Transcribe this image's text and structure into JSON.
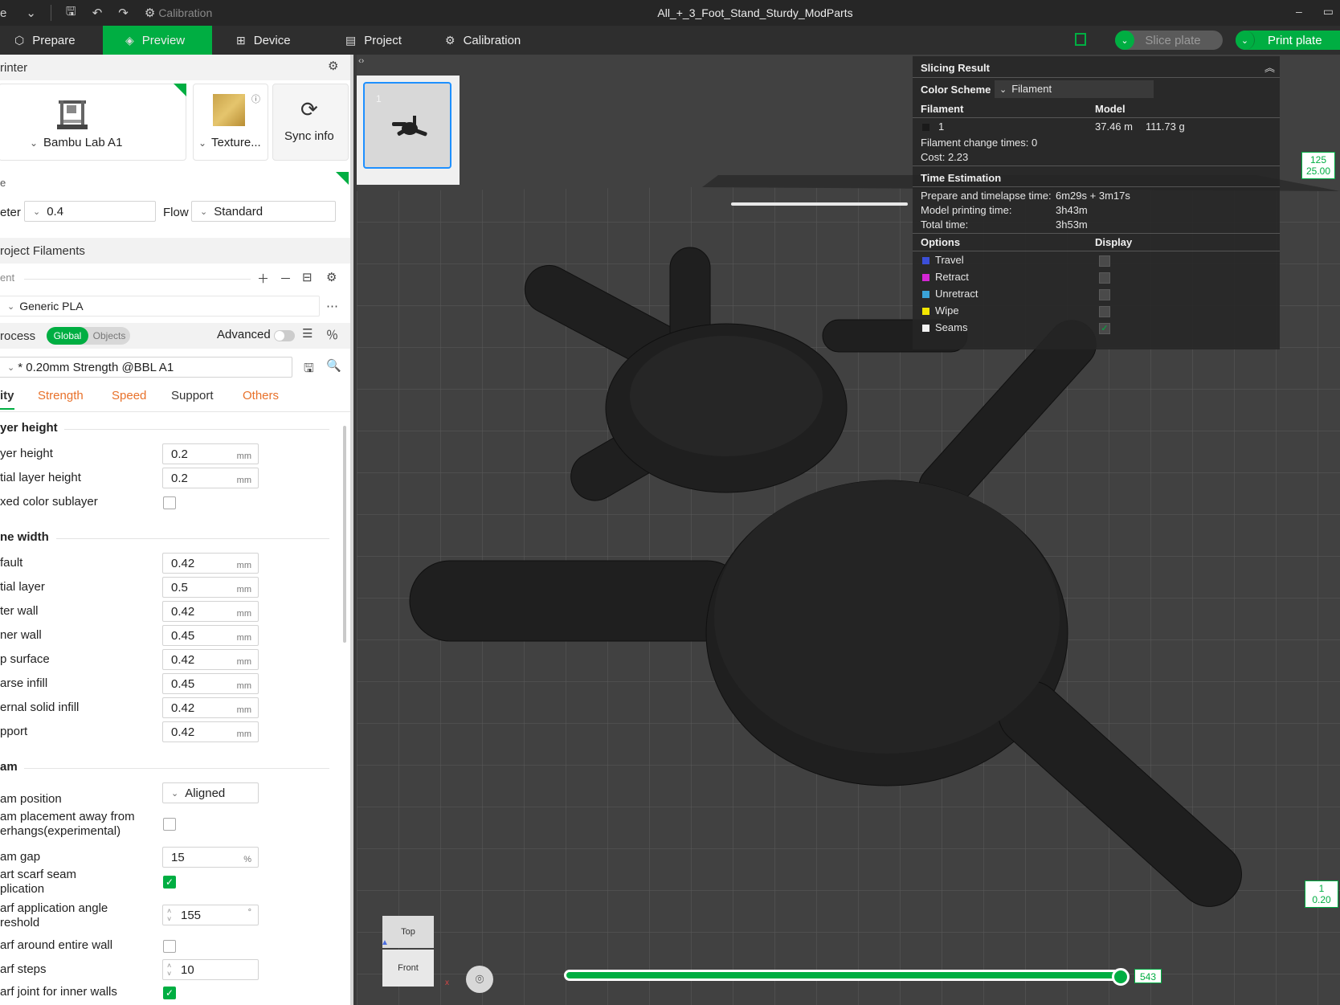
{
  "titlebar": {
    "app_menu": "e",
    "calibration_label": "Calibration",
    "title": "All_+_3_Foot_Stand_Sturdy_ModParts"
  },
  "nav": {
    "tabs": [
      {
        "label": "Prepare"
      },
      {
        "label": "Preview"
      },
      {
        "label": "Device"
      },
      {
        "label": "Project"
      },
      {
        "label": "Calibration"
      }
    ],
    "slice_label": "Slice plate",
    "print_label": "Print plate"
  },
  "printer": {
    "header": "rinter",
    "printer_name": "Bambu Lab A1",
    "plate_name": "Texture...",
    "sync_label": "Sync info",
    "nozzle_section": "e",
    "diameter_label": "eter",
    "diameter_value": "0.4",
    "flow_label": "Flow",
    "flow_value": "Standard"
  },
  "filaments": {
    "header": "roject Filaments",
    "sub_label": "ent",
    "item": "Generic PLA"
  },
  "process": {
    "header": "rocess",
    "toggle_global": "Global",
    "toggle_objects": "Objects",
    "advanced_label": "Advanced",
    "preset": "* 0.20mm Strength @BBL A1",
    "tabs": [
      "ity",
      "Strength",
      "Speed",
      "Support",
      "Others"
    ]
  },
  "settings": {
    "layer_height_group": "yer height",
    "layer_height_label": "yer height",
    "layer_height_value": "0.2",
    "initial_layer_height_label": "tial layer height",
    "initial_layer_height_value": "0.2",
    "mixed_color_label": "xed color sublayer",
    "line_width_group": "ne width",
    "default_label": "fault",
    "default_value": "0.42",
    "initial_layer_label": "tial layer",
    "initial_layer_value": "0.5",
    "outer_wall_label": "ter wall",
    "outer_wall_value": "0.42",
    "inner_wall_label": "ner wall",
    "inner_wall_value": "0.45",
    "top_surface_label": "p surface",
    "top_surface_value": "0.42",
    "sparse_infill_label": "arse infill",
    "sparse_infill_value": "0.45",
    "internal_solid_label": "ernal solid infill",
    "internal_solid_value": "0.42",
    "support_label": "pport",
    "support_value": "0.42",
    "seam_group": "am",
    "seam_position_label": "am position",
    "seam_position_value": "Aligned",
    "seam_away_label_1": "am placement away from",
    "seam_away_label_2": "erhangs(experimental)",
    "seam_gap_label": "am gap",
    "seam_gap_value": "15",
    "smart_scarf_label_1": "art scarf seam",
    "smart_scarf_label_2": "plication",
    "scarf_angle_label_1": "arf application angle",
    "scarf_angle_label_2": "reshold",
    "scarf_angle_value": "155",
    "scarf_entire_label": "arf around entire wall",
    "scarf_steps_label": "arf steps",
    "scarf_steps_value": "10",
    "scarf_inner_label": "arf joint for inner walls",
    "unit_mm": "mm",
    "unit_pct": "%",
    "unit_deg": "°"
  },
  "slicing_result": {
    "title": "Slicing Result",
    "color_scheme_label": "Color Scheme",
    "color_scheme_value": "Filament",
    "col_filament": "Filament",
    "col_model": "Model",
    "filament_id": "1",
    "length": "37.46 m",
    "weight": "111.73 g",
    "change_times": "Filament change times:  0",
    "cost": "Cost:  2.23",
    "time_title": "Time Estimation",
    "prepare_label": "Prepare and timelapse time:",
    "prepare_value": "6m29s + 3m17s",
    "model_label": "Model printing time:",
    "model_value": "3h43m",
    "total_label": "Total time:",
    "total_value": "3h53m",
    "options_label": "Options",
    "display_label": "Display",
    "options": [
      {
        "label": "Travel",
        "color": "#3b4fd8"
      },
      {
        "label": "Retract",
        "color": "#d426d4"
      },
      {
        "label": "Unretract",
        "color": "#3aa3d8"
      },
      {
        "label": "Wipe",
        "color": "#f2e600"
      },
      {
        "label": "Seams",
        "color": "#f2f2f2"
      }
    ]
  },
  "viewport": {
    "plate_number": "1",
    "top_layer_1": "125",
    "top_layer_2": "25.00",
    "bottom_layer_1": "1",
    "bottom_layer_2": "0.20",
    "progress": "543",
    "view_top": "Top",
    "view_front": "Front"
  }
}
